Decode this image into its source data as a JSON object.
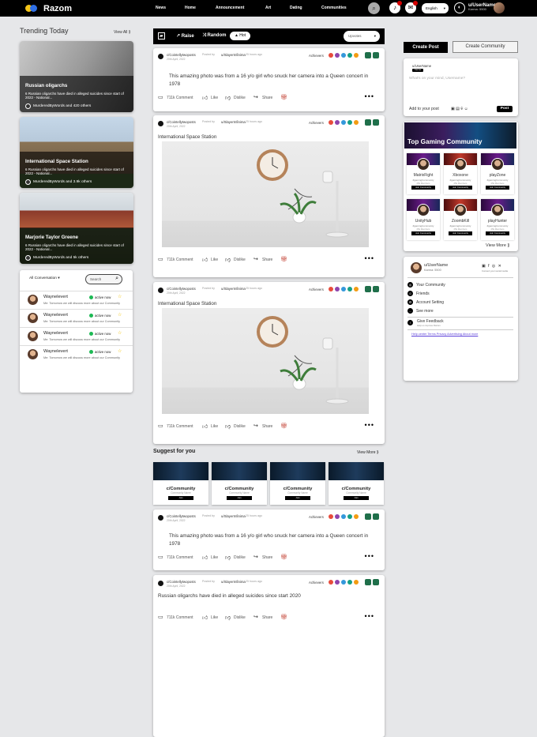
{
  "header": {
    "logo": "Razom",
    "nav": [
      "News",
      "Home",
      "Announcement",
      "Art",
      "Dating",
      "Communities"
    ],
    "language": "English",
    "username": "u/UserName",
    "karma": "Karma: 5500"
  },
  "trending": {
    "title": "Trending Today",
    "view_all": "View All ⟫",
    "cards": [
      {
        "title": "Russian oligarchs",
        "desc": "6 Russian oligarchs have died in alleged suicides since start of 2022 - National...",
        "by": "MurderedByWords and 420 others"
      },
      {
        "title": "International Space Station",
        "desc": "6 Russian oligarchs have died in alleged suicides since start of 2022 - National...",
        "by": "MurderedByWords and 3.9k others"
      },
      {
        "title": "Marjorie Taylor Greene",
        "desc": "6 Russian oligarchs have died in alleged suicides since start of 2022 - National...",
        "by": "MurderedByWords and 5k others"
      }
    ]
  },
  "conversation": {
    "filter": "All Conversation",
    "search_placeholder": "Search",
    "rows": [
      {
        "name": "Waynelevert",
        "status": "active now",
        "msg": "Me: Tomorrow we will discuss more about our Community"
      },
      {
        "name": "Waynelevert",
        "status": "active now",
        "msg": "Me: Tomorrow we will discuss more about our Community"
      },
      {
        "name": "Waynelevert",
        "status": "active now",
        "msg": "Me: Tomorrow we will discuss more about our Community"
      },
      {
        "name": "Waynelevert",
        "status": "active now",
        "msg": "Me: Tomorrow we will discuss more about our Community"
      }
    ]
  },
  "feedbar": {
    "raise": "Raise",
    "random": "Random",
    "hot": "Hot",
    "sort": "Upvotes"
  },
  "post_meta": {
    "community": "c/Cointellytwoposts",
    "posted_by": "Posted by",
    "user": "u/SlayerInfinima",
    "age": "25 hours ago",
    "date": "20th April, 2022",
    "achievers": "Achievers"
  },
  "posts": [
    {
      "text": "This amazing photo was from a 16 y/o girl who snuck her camera into a Queen concert in 1978"
    },
    {
      "title": "International Space Station"
    },
    {
      "title": "International Space Station"
    },
    {
      "text": "This amazing photo was from a 16 y/o girl who snuck her camera into a Queen concert in 1978"
    },
    {
      "text": "Russian oligarchs have died in alleged suicides since start 2020"
    }
  ],
  "actions": {
    "comment": "711k Comment",
    "like": "Like",
    "dislike": "Dislike",
    "share": "Share"
  },
  "suggest": {
    "title": "Suggest for you",
    "view_more": "View More ⟫",
    "card_name": "c/Community",
    "card_sub": "Community Name",
    "card_join": "Join"
  },
  "sidebar": {
    "create_post": "Create Post",
    "create_community": "Create Community",
    "composer_user": "u/UserName",
    "composer_tag": "Karma",
    "composer_placeholder": "What's on your mind, Username?",
    "add_to_post": "Add to your post",
    "post_btn": "Post",
    "gaming_title": "Top Gaming Community",
    "gaming": [
      {
        "name": "MatrixFight",
        "handle": "#gamingCommunity",
        "members": "25k Members",
        "join": "Join Community"
      },
      {
        "name": "Xboxone",
        "handle": "#gamingCommunity",
        "members": "25k Members",
        "join": "Join Community"
      },
      {
        "name": "playZone",
        "handle": "#gamingCommunity",
        "members": "25k Members",
        "join": "Join Community"
      },
      {
        "name": "UnityHub",
        "handle": "#gamingCommunity",
        "members": "25k Members",
        "join": "Join Community"
      },
      {
        "name": "ZoombKill",
        "handle": "#gamingCommunity",
        "members": "25k Members",
        "join": "Join Community"
      },
      {
        "name": "playHunter",
        "handle": "#gamingCommunity",
        "members": "25k Members",
        "join": "Join Community"
      }
    ],
    "gaming_view_more": "View More ⟫",
    "menu_user": "u/UserName",
    "menu_karma": "Karma: 5500",
    "menu_social_caption": "Connect your social media",
    "menu_items": [
      "Your Community",
      "Friends",
      "Account Setting",
      "See more"
    ],
    "feedback": "Give Feedback",
    "feedback_sub": "Help us improve Razom",
    "footer_links": "Help center Terms Privacy Advertising About more"
  }
}
